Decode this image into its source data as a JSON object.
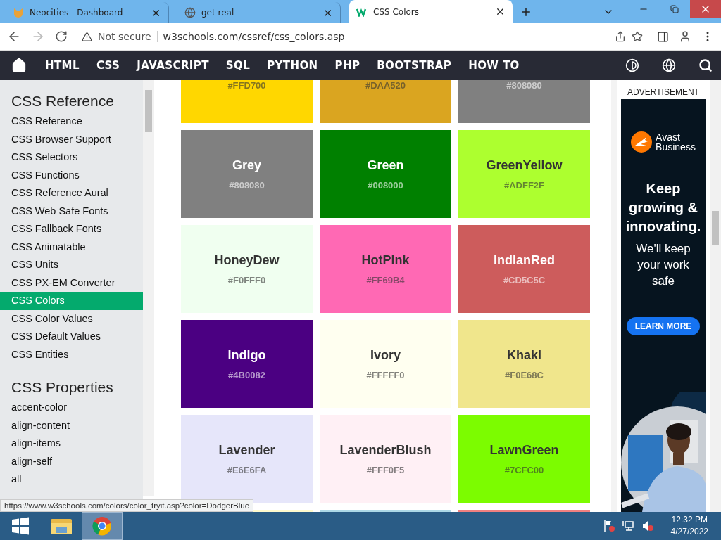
{
  "browser": {
    "tabs": [
      {
        "title": "Neocities - Dashboard",
        "selected": false
      },
      {
        "title": "get real",
        "selected": false
      },
      {
        "title": "CSS Colors",
        "selected": true
      }
    ],
    "security": "Not secure",
    "url": "w3schools.com/cssref/css_colors.asp"
  },
  "navbar": {
    "items": [
      "HTML",
      "CSS",
      "JAVASCRIPT",
      "SQL",
      "PYTHON",
      "PHP",
      "BOOTSTRAP",
      "HOW TO"
    ]
  },
  "sidebar": {
    "sections": [
      {
        "heading": "CSS Reference",
        "items": [
          {
            "label": "CSS Reference",
            "selected": false
          },
          {
            "label": "CSS Browser Support",
            "selected": false
          },
          {
            "label": "CSS Selectors",
            "selected": false
          },
          {
            "label": "CSS Functions",
            "selected": false
          },
          {
            "label": "CSS Reference Aural",
            "selected": false
          },
          {
            "label": "CSS Web Safe Fonts",
            "selected": false
          },
          {
            "label": "CSS Fallback Fonts",
            "selected": false
          },
          {
            "label": "CSS Animatable",
            "selected": false
          },
          {
            "label": "CSS Units",
            "selected": false
          },
          {
            "label": "CSS PX-EM Converter",
            "selected": false
          },
          {
            "label": "CSS Colors",
            "selected": true
          },
          {
            "label": "CSS Color Values",
            "selected": false
          },
          {
            "label": "CSS Default Values",
            "selected": false
          },
          {
            "label": "CSS Entities",
            "selected": false
          }
        ]
      },
      {
        "heading": "CSS Properties",
        "items": [
          {
            "label": "accent-color",
            "selected": false
          },
          {
            "label": "align-content",
            "selected": false
          },
          {
            "label": "align-items",
            "selected": false
          },
          {
            "label": "align-self",
            "selected": false
          },
          {
            "label": "all",
            "selected": false
          }
        ]
      }
    ]
  },
  "color_rows": [
    {
      "kind": "top-cut",
      "cards": [
        {
          "hex": "#FFD700",
          "color": "#ffd700"
        },
        {
          "hex": "#DAA520",
          "color": "#daa520"
        },
        {
          "hex": "#808080",
          "color": "#808080"
        }
      ]
    },
    {
      "kind": "full",
      "cards": [
        {
          "name": "Grey",
          "hex": "#808080",
          "color": "#808080"
        },
        {
          "name": "Green",
          "hex": "#008000",
          "color": "#008000"
        },
        {
          "name": "GreenYellow",
          "hex": "#ADFF2F",
          "color": "#adff2f"
        }
      ]
    },
    {
      "kind": "full",
      "cards": [
        {
          "name": "HoneyDew",
          "hex": "#F0FFF0",
          "color": "#f0fff0"
        },
        {
          "name": "HotPink",
          "hex": "#FF69B4",
          "color": "#ff69b4"
        },
        {
          "name": "IndianRed",
          "hex": "#CD5C5C",
          "color": "#cd5c5c"
        }
      ]
    },
    {
      "kind": "full",
      "cards": [
        {
          "name": "Indigo",
          "hex": "#4B0082",
          "color": "#4b0082"
        },
        {
          "name": "Ivory",
          "hex": "#FFFFF0",
          "color": "#fffff0"
        },
        {
          "name": "Khaki",
          "hex": "#F0E68C",
          "color": "#f0e68c"
        }
      ]
    },
    {
      "kind": "full",
      "cards": [
        {
          "name": "Lavender",
          "hex": "#E6E6FA",
          "color": "#e6e6fa"
        },
        {
          "name": "LavenderBlush",
          "hex": "#FFF0F5",
          "color": "#fff0f5"
        },
        {
          "name": "LawnGreen",
          "hex": "#7CFC00",
          "color": "#7cfc00"
        }
      ]
    },
    {
      "kind": "bottom-cut",
      "cards": [
        {
          "color": "#fffacd"
        },
        {
          "color": "#add8e6"
        },
        {
          "color": "#f08080"
        }
      ]
    }
  ],
  "ad": {
    "label": "ADVERTISEMENT",
    "brand_line_1": "Avast",
    "brand_line_2": "Business",
    "headline": "Keep growing & innovating.",
    "subline": "We'll keep your work safe",
    "button": "LEARN MORE"
  },
  "status_url": "https://www.w3schools.com/colors/color_tryit.asp?color=DodgerBlue",
  "taskbar": {
    "time": "12:32 PM",
    "date": "4/27/2022"
  }
}
